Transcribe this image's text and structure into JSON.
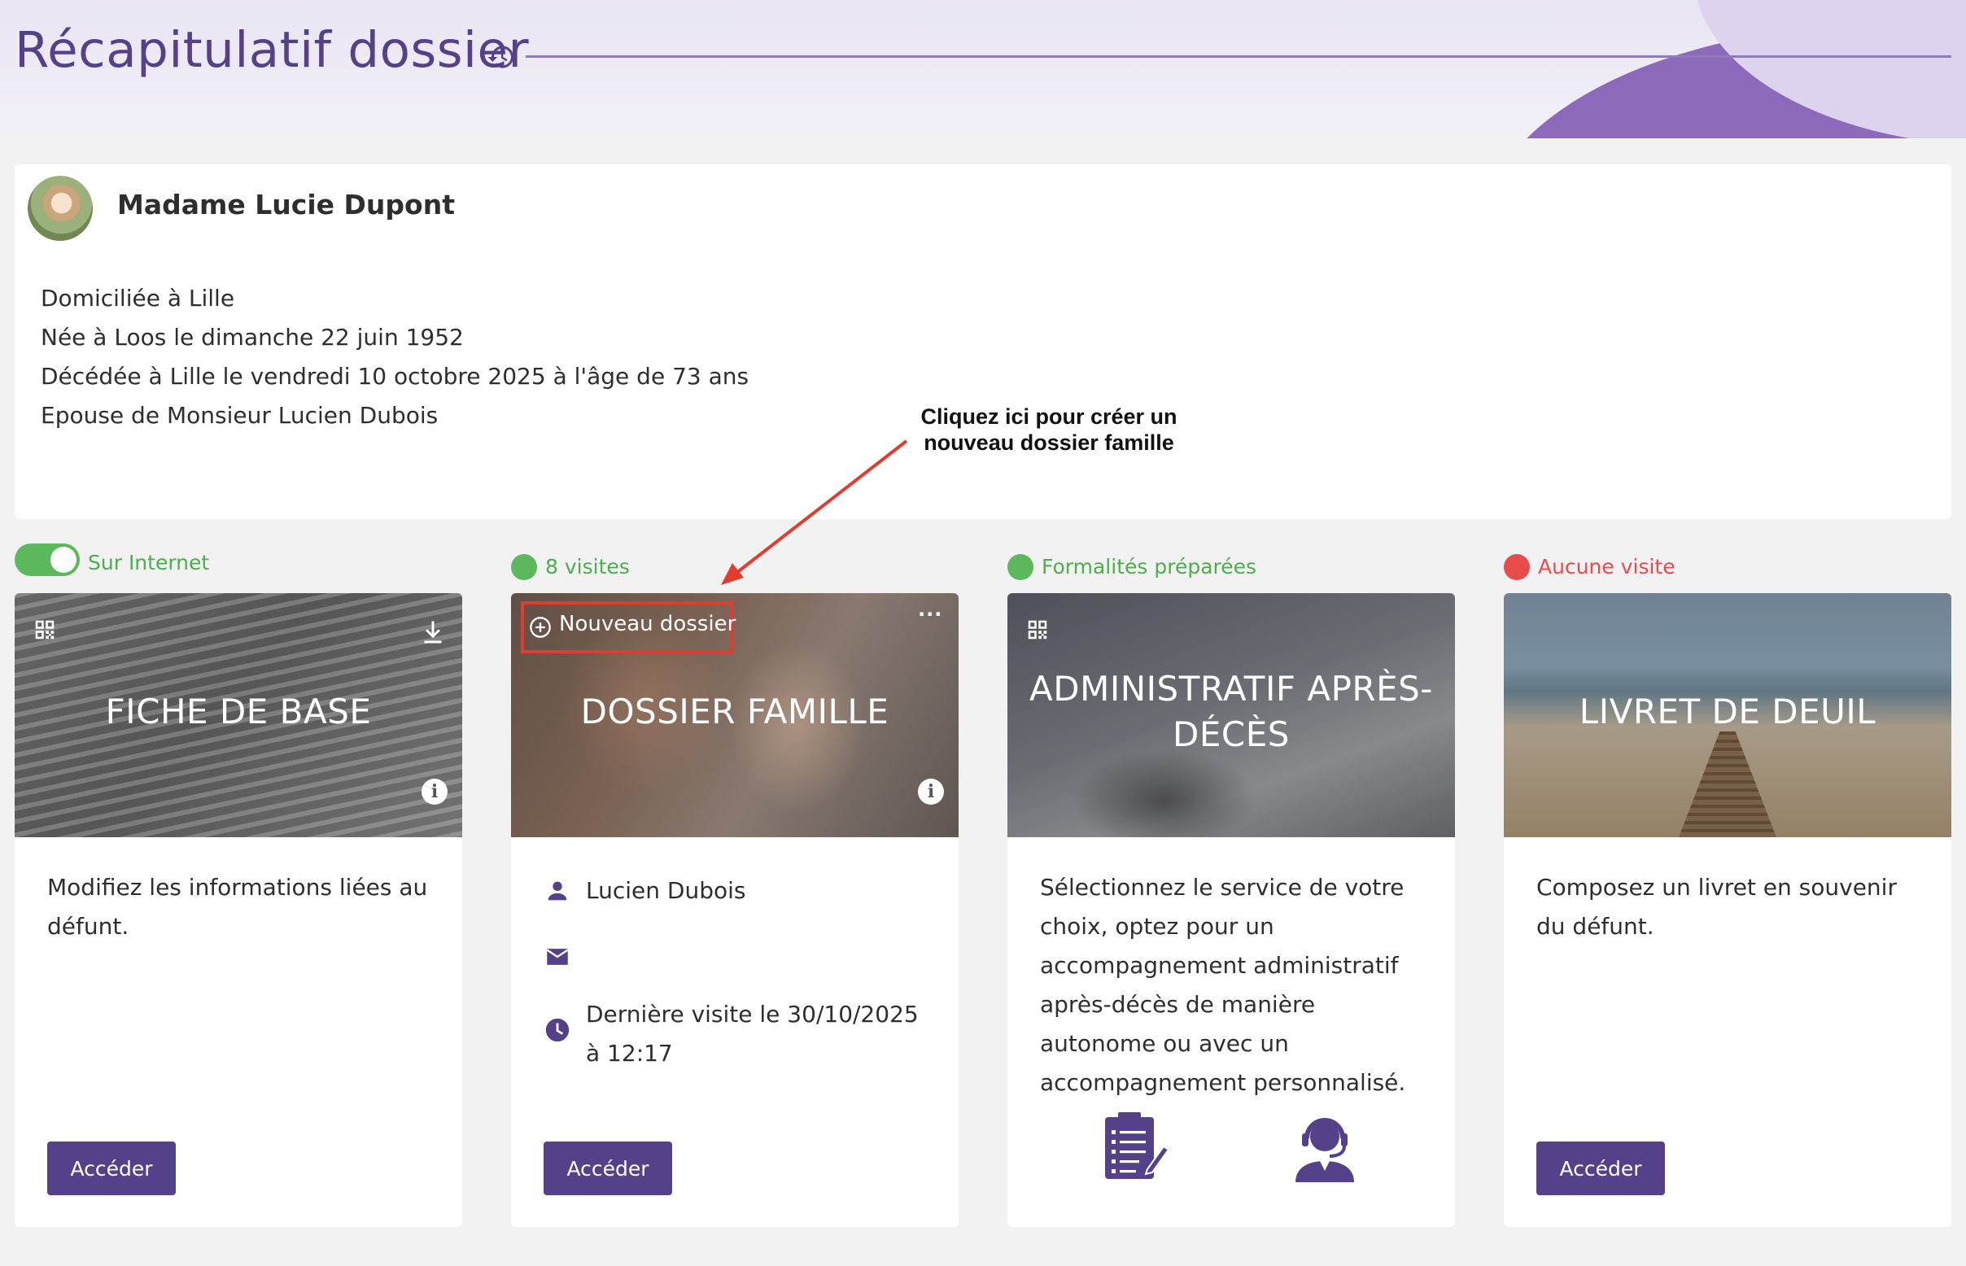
{
  "header": {
    "title": "Récapitulatif dossier",
    "history_icon": "history-icon"
  },
  "profile": {
    "name": "Madame Lucie Dupont",
    "lines": [
      "Domiciliée à Lille",
      "Née à Loos le dimanche 22 juin 1952",
      "Décédée à Lille le vendredi 10 octobre 2025 à l'âge de 73 ans",
      "Epouse de Monsieur Lucien Dubois"
    ]
  },
  "annotation": {
    "line1": "Cliquez ici pour créer un",
    "line2": "nouveau dossier famille"
  },
  "statuses": {
    "fiche": "Sur Internet",
    "famille": "8 visites",
    "admin": "Formalités préparées",
    "livret": "Aucune visite"
  },
  "colors": {
    "brand": "#55408a",
    "ok": "#5cb85c",
    "alert": "#e94b4b",
    "annotation": "#e23b2f"
  },
  "cards": {
    "fiche": {
      "title": "FICHE DE BASE",
      "description": "Modifiez les informations liées au défunt.",
      "button": "Accéder"
    },
    "famille": {
      "title": "DOSSIER FAMILLE",
      "new_folder": "Nouveau dossier",
      "menu": "···",
      "contact_name": "Lucien Dubois",
      "last_visit_line1": "Dernière visite le 30/10/2025",
      "last_visit_line2": "à 12:17",
      "button": "Accéder"
    },
    "admin": {
      "title_line1": "ADMINISTRATIF APRÈS-",
      "title_line2": "DÉCÈS",
      "description": "Sélectionnez le service de votre choix, optez pour un accompagnement administratif après-décès de manière autonome ou avec un accompagnement personnalisé."
    },
    "livret": {
      "title": "LIVRET DE DEUIL",
      "description": "Composez un livret en souvenir du défunt.",
      "button": "Accéder"
    }
  },
  "info_glyph": "i"
}
